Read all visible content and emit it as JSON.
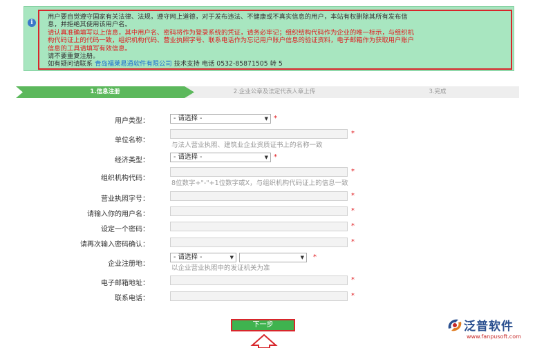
{
  "notice": {
    "icon": "info-icon",
    "lines": [
      "用户要自觉遵守国家有关法律、法规，遵守网上道德，对于发布违法、不健康或不真实信息的用户，本站有权删除其所有发布信",
      "息，并拒绝其使用该用户名。",
      "请认真准确填写以上信息，其中用户名、密码将作为登录系统的凭证，请务必牢记；组织结构代码作为企业的唯一标示，与组织机",
      "构代码证上的代码一致，组织机构代码、营业执照字号、联系电话作为忘记用户账户信息的验证资料，电子邮箱作为获取用户账户",
      "信息的工具请填写有效信息。",
      "请不要重复注册。"
    ],
    "contact_prefix": "如有疑问请联系",
    "contact_company": "青岛福莱易通软件有限公司",
    "contact_suffix": "技术支持 电话 0532-85871505 转 5"
  },
  "steps": [
    "1.信息注册",
    "2.企业公章及法定代表人章上传",
    "3.完成"
  ],
  "form": {
    "user_type_label": "用户类型：",
    "user_type_value": "- 请选择 -",
    "org_name_label": "单位名称：",
    "org_name_hint": "与法人营业执照、建筑业企业资质证书上的名称一致",
    "econ_type_label": "经济类型：",
    "econ_type_value": "- 请选择 -",
    "org_code_label": "组织机构代码：",
    "org_code_hint": "8位数字+\"-\"+1位数字或X，与组织机构代码证上的信息一致",
    "license_label": "营业执照字号：",
    "username_label": "请输入你的用户名：",
    "password_label": "设定一个密码：",
    "password_confirm_label": "请再次输入密码确认：",
    "region_label": "企业注册地：",
    "region_value": "- 请选择 -",
    "region_hint": "以企业营业执照中的发证机关为准",
    "email_label": "电子邮箱地址：",
    "phone_label": "联系电话：",
    "required_mark": "*"
  },
  "next_button": "下一步",
  "logo": {
    "name": "泛普软件",
    "url": "www.fanpusoft.com"
  }
}
